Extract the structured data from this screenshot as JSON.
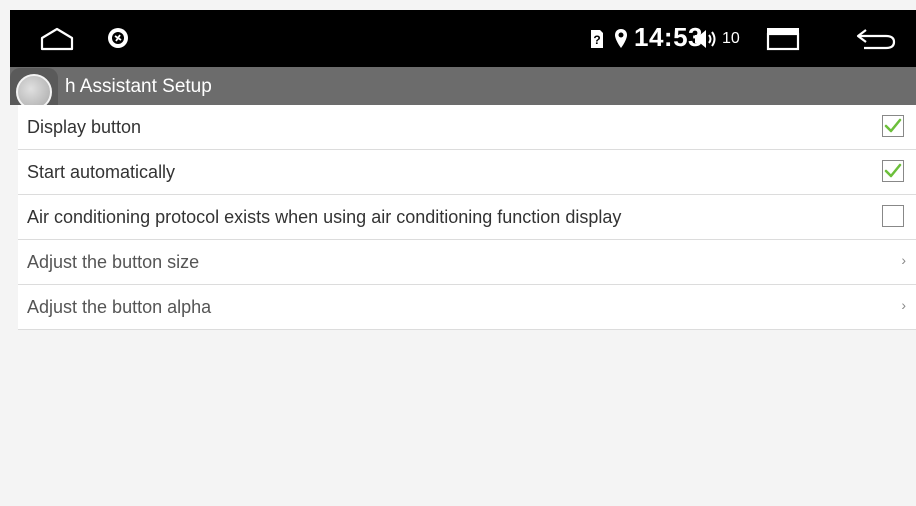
{
  "status_bar": {
    "home_icon": "home-icon",
    "app_icon": "app-badge-icon",
    "sim_icon": "sim-unknown-icon",
    "location_icon": "location-pin-icon",
    "time": "14:53",
    "volume_icon": "volume-icon",
    "volume_level": "10",
    "recents_icon": "recents-icon",
    "back_icon": "back-icon"
  },
  "title_bar": {
    "title": "h Assistant Setup"
  },
  "settings": {
    "display_button": {
      "label": "Display button",
      "checked": true
    },
    "start_automatically": {
      "label": "Start automatically",
      "checked": true
    },
    "air_conditioning": {
      "label": "Air conditioning protocol exists when using air conditioning function display",
      "checked": false
    },
    "button_size": {
      "label": "Adjust the button size",
      "chevron": "›"
    },
    "button_alpha": {
      "label": "Adjust the button alpha",
      "chevron": "›"
    }
  },
  "colors": {
    "status_bar_bg": "#000000",
    "title_bar_bg": "#6c6c6c",
    "checkmark": "#6cbf3b",
    "background": "#f4f4f4"
  }
}
